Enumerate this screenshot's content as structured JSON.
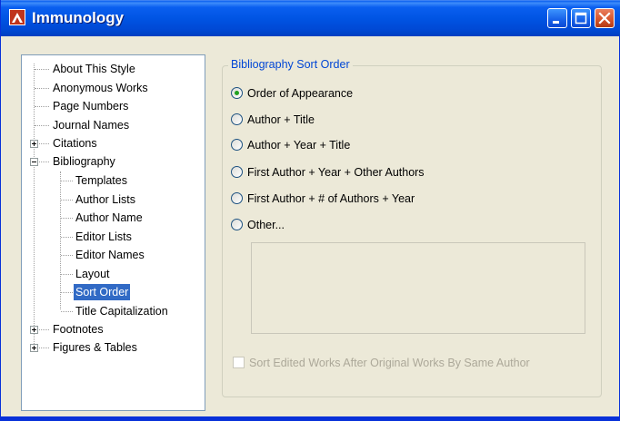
{
  "window": {
    "title": "Immunology"
  },
  "title_buttons": {
    "minimize": "minimize-icon",
    "maximize": "maximize-icon",
    "close": "close-icon"
  },
  "tree": {
    "items": [
      {
        "label": "About This Style"
      },
      {
        "label": "Anonymous Works"
      },
      {
        "label": "Page Numbers"
      },
      {
        "label": "Journal Names"
      },
      {
        "label": "Citations",
        "expander": "+"
      },
      {
        "label": "Bibliography",
        "expander": "-"
      },
      {
        "label": "Templates"
      },
      {
        "label": "Author Lists"
      },
      {
        "label": "Author Name"
      },
      {
        "label": "Editor Lists"
      },
      {
        "label": "Editor Names"
      },
      {
        "label": "Layout"
      },
      {
        "label": "Sort Order",
        "selected": true
      },
      {
        "label": "Title Capitalization"
      },
      {
        "label": "Footnotes",
        "expander": "+"
      },
      {
        "label": "Figures & Tables",
        "expander": "+"
      }
    ]
  },
  "sort_group": {
    "legend": "Bibliography Sort Order",
    "options": [
      {
        "label": "Order of Appearance",
        "checked": true
      },
      {
        "label": "Author + Title",
        "checked": false
      },
      {
        "label": "Author + Year + Title",
        "checked": false
      },
      {
        "label": "First Author + Year + Other Authors",
        "checked": false
      },
      {
        "label": "First Author + # of Authors + Year",
        "checked": false
      },
      {
        "label": "Other...",
        "checked": false
      }
    ],
    "other_text": "",
    "checkbox": {
      "label": "Sort Edited Works After Original Works By Same Author",
      "checked": false,
      "disabled": true
    }
  },
  "colors": {
    "titlebar": "#0054e3",
    "selection": "#316ac5",
    "legend": "#0046d5",
    "radio_dot": "#21a121",
    "dialog_bg": "#ece9d8"
  }
}
